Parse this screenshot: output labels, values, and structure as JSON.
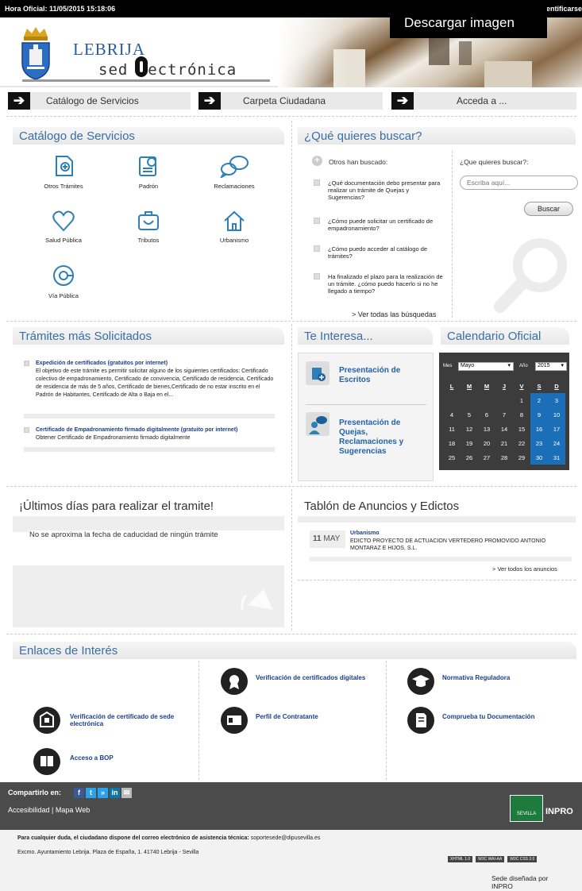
{
  "topbar": {
    "hora": "Hora Oficial: 11/05/2015 15:18:06",
    "ident": "entificarse",
    "download": "Descargar imagen"
  },
  "header": {
    "city": "LEBRIJA",
    "sede": "sed lectrónica"
  },
  "nav": [
    {
      "label": "Catálogo de Servicios",
      "arrow": "➔"
    },
    {
      "label": "Carpeta Ciudadana",
      "arrow": "➔"
    },
    {
      "label": "Acceda a ...",
      "arrow": "➔"
    }
  ],
  "catalogo": {
    "title": "Catálogo de Servicios",
    "items": [
      {
        "label": "Otros Trámites",
        "icon": "document-plus-icon"
      },
      {
        "label": "Padrón",
        "icon": "certificate-icon"
      },
      {
        "label": "Reclamaciones",
        "icon": "speech-bubble-icon"
      },
      {
        "label": "Salud Pública",
        "icon": "heart-icon"
      },
      {
        "label": "Tributos",
        "icon": "briefcase-icon"
      },
      {
        "label": "Urbanismo",
        "icon": "house-icon"
      },
      {
        "label": "Vía Pública",
        "icon": "road-icon"
      }
    ]
  },
  "buscar": {
    "title": "¿Qué quieres buscar?",
    "others": "Otros han buscado:",
    "questions": [
      "¿Qué documentación debo presentar para realizar un trámite de Quejas y Sugerencias?",
      "¿Cómo puede solicitar un certificado de empadronamiento?",
      "¿Cómo puedo acceder al catálogo de trámites?",
      "Ha finalizado el plazo para la realización de un trámite. ¿cómo puedo hacerlo si no he llegado a tiempo?"
    ],
    "ver_todas": "> Ver todas las búsquedas",
    "label": "¿Que quieres buscar?:",
    "placeholder": "Escriba aquí...",
    "button": "Buscar"
  },
  "tramites": {
    "title": "Trámites más Solicitados",
    "items": [
      {
        "title": "Expedición de certificados (gratuitos por internet)",
        "desc": "El objetivo de este trámite es permitir solicitar alguno de los siguientes certificados: Certificado colectivo de empadronamiento, Certificado de convivencia, Certificado de residencia, Certificado de residencia de más de 5 años, Certificado de bienes,Certificado de no estar inscrito en el Padrón de Habitantes, Certificado de Alta o Baja en el..."
      },
      {
        "title": "Certificado de Empadronamiento firmado digitalmente (gratuito por internet)",
        "desc": "Obtener Certificado de Empadronamiento firmado digitalmente"
      }
    ]
  },
  "interesa": {
    "title": "Te Interesa...",
    "items": [
      "Presentación de Escritos",
      "Presentación de Quejas, Reclamaciones y Sugerencias"
    ]
  },
  "calendario": {
    "title": "Calendario Oficial",
    "mes_label": "Mes",
    "mes": "Mayo",
    "anio_label": "Año",
    "anio": "2015",
    "headers": [
      "L",
      "M",
      "M",
      "J",
      "V",
      "S",
      "D"
    ],
    "days": [
      "",
      "",
      "",
      "",
      "1",
      "2",
      "3",
      "4",
      "5",
      "6",
      "7",
      "8",
      "9",
      "10",
      "11",
      "12",
      "13",
      "14",
      "15",
      "16",
      "17",
      "18",
      "19",
      "20",
      "21",
      "22",
      "23",
      "24",
      "25",
      "26",
      "27",
      "28",
      "29",
      "30",
      "31"
    ]
  },
  "ultimos": {
    "title": "¡Últimos días para realizar el tramite!",
    "text": "No se aproxima la fecha de caducidad de ningún trámite"
  },
  "tablon": {
    "title": "Tablón de Anuncios y Edictos",
    "day": "11",
    "month": "MAY",
    "cat": "Urbanismo",
    "text": "EDICTO PROYECTO DE ACTUACION VERTEDERO PROMOVIDO ANTONIO MONTARAZ E HIJOS, S.L.",
    "ver": "> Ver todos los anuncios"
  },
  "enlaces": {
    "title": "Enlaces de Interés",
    "items": [
      "Verificación de certificados digitales",
      "Normativa Reguladora",
      "Verificación de certificado de sede electrónica",
      "Perfil de Contratante",
      "Comprueba tu Documentación",
      "Acceso a BOP"
    ]
  },
  "footer": {
    "compartir": "Compartirlo en:",
    "links": "Accesibilidad | Mapa Web",
    "diputacion": "SEVILLA",
    "inpro": "INPRO",
    "contacto": "Para cualquier duda, el ciudadano dispone del correo electrónico de asistencia técnica:",
    "email": "soportesede@dipusevilla.es",
    "direccion": "Excmo. Ayuntamiento Lebrija. Plaza de España, 1. 41740 Lebrija - Sevilla",
    "badges": [
      "XHTML 1.0",
      "W3C WAI-AA",
      "W3C CSS 2.0"
    ],
    "disenada": "Sede diseñada por INPRO"
  },
  "colors": {
    "title_blue": "#3a6ea5",
    "link_blue": "#1a3e8a",
    "weekend_blue": "#1b6fb8"
  }
}
